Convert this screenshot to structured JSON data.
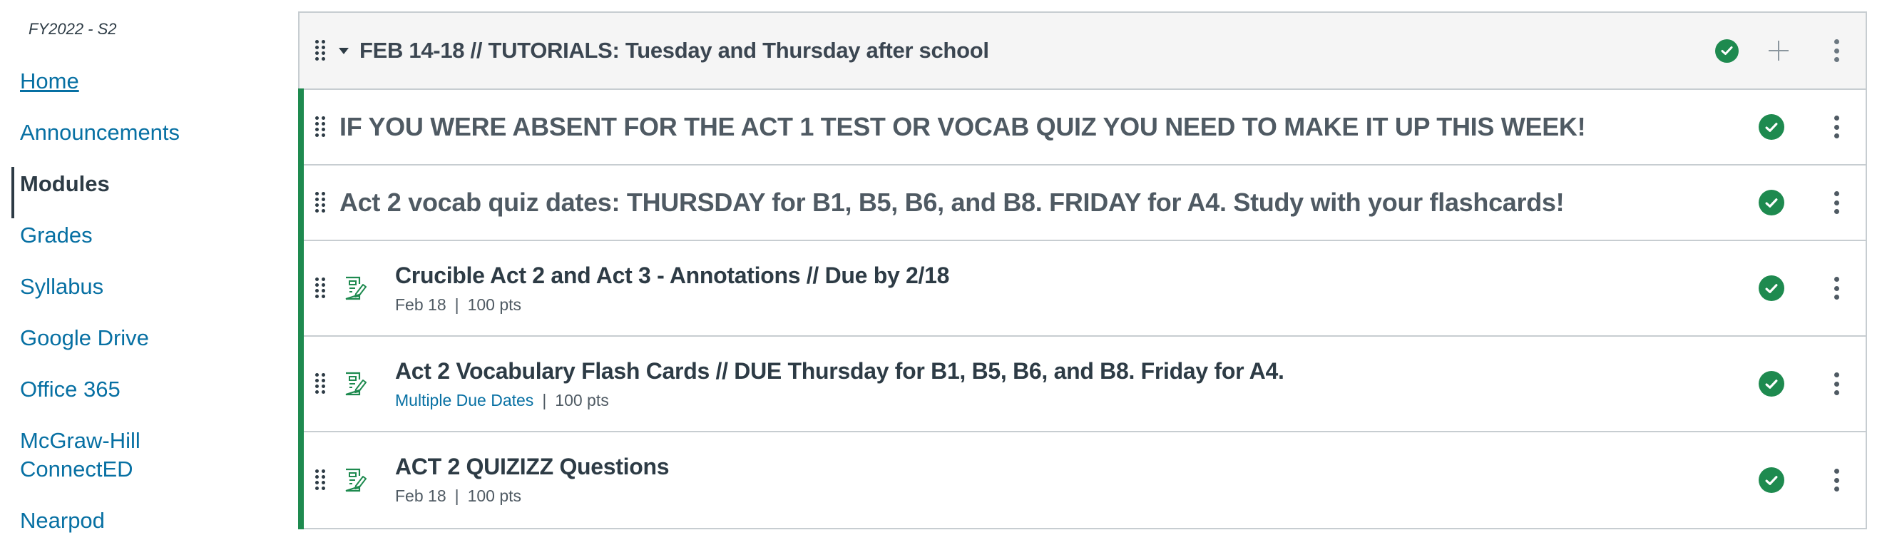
{
  "sidebar": {
    "term": "FY2022 - S2",
    "nav": [
      {
        "label": "Home",
        "state": "hover-underlined"
      },
      {
        "label": "Announcements"
      },
      {
        "label": "Modules",
        "state": "active"
      },
      {
        "label": "Grades"
      },
      {
        "label": "Syllabus"
      },
      {
        "label": "Google Drive"
      },
      {
        "label": "Office 365"
      },
      {
        "label": "McGraw-Hill ConnectED"
      },
      {
        "label": "Nearpod"
      }
    ]
  },
  "module": {
    "title": "FEB 14-18 // TUTORIALS: Tuesday and Thursday after school",
    "published": true,
    "icons": {
      "drag": "drag-handle-icon",
      "collapse": "caret-down-icon",
      "publish": "check-circle-icon",
      "add": "plus-icon",
      "menu": "kebab-icon"
    },
    "items": [
      {
        "type": "subheader",
        "text": "IF YOU WERE ABSENT FOR THE ACT 1 TEST OR VOCAB QUIZ YOU NEED TO MAKE IT UP THIS WEEK!",
        "published": true
      },
      {
        "type": "subheader",
        "text": "Act 2 vocab quiz dates: THURSDAY for B1, B5, B6, and B8. FRIDAY for A4. Study with your flashcards!",
        "published": true
      },
      {
        "type": "assignment",
        "title": "Crucible Act 2 and Act 3 - Annotations // Due by 2/18",
        "due": "Feb 18",
        "points": "100 pts",
        "published": true
      },
      {
        "type": "assignment",
        "title": "Act 2 Vocabulary Flash Cards // DUE Thursday for B1, B5, B6, and B8. Friday for A4.",
        "due": "Multiple Due Dates",
        "due_is_link": true,
        "points": "100 pts",
        "published": true
      },
      {
        "type": "assignment",
        "title": "ACT 2 QUIZIZZ Questions",
        "due": "Feb 18",
        "points": "100 pts",
        "published": true
      }
    ]
  },
  "colors": {
    "link": "#0770a3",
    "text": "#2d3b45",
    "published_green": "#1e8a4f",
    "border": "#c7cdd1",
    "header_bg": "#f5f5f5"
  },
  "meta_separator": "|"
}
